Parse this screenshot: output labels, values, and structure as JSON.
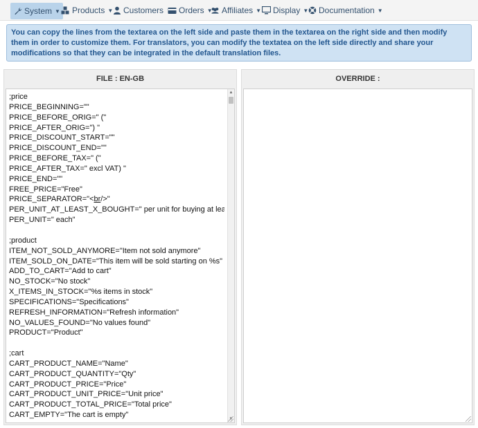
{
  "nav": {
    "items": [
      {
        "label": "System",
        "icon": "wrench-icon",
        "active": true
      },
      {
        "label": "Products",
        "icon": "cubes-icon"
      },
      {
        "label": "Customers",
        "icon": "user-icon"
      },
      {
        "label": "Orders",
        "icon": "credit-card-icon"
      },
      {
        "label": "Affiliates",
        "icon": "users-icon"
      },
      {
        "label": "Display",
        "icon": "monitor-icon"
      },
      {
        "label": "Documentation",
        "icon": "lifebuoy-icon"
      }
    ]
  },
  "info": {
    "text": "You can copy the lines from the textarea on the left side and paste them in the textarea on the right side and then modify them in order to customize them. For translators, you can modify the textatea on the left side directly and share your modifications so that they can be integrated in the default translation files."
  },
  "left_panel": {
    "title": "FILE : EN-GB",
    "lines": [
      ";price",
      "PRICE_BEGINNING=\"\"",
      "PRICE_BEFORE_ORIG=\" (\"",
      "PRICE_AFTER_ORIG=\") \"",
      "PRICE_DISCOUNT_START=\"\"",
      "PRICE_DISCOUNT_END=\"\"",
      "PRICE_BEFORE_TAX=\" (\"",
      "PRICE_AFTER_TAX=\" excl VAT) \"",
      "PRICE_END=\"\"",
      "FREE_PRICE=\"Free\"",
      "PRICE_SEPARATOR=\"<br/>\"",
      "PER_UNIT_AT_LEAST_X_BOUGHT=\" per unit for buying at least %s\"",
      "PER_UNIT=\" each\"",
      "",
      ";product",
      "ITEM_NOT_SOLD_ANYMORE=\"Item not sold anymore\"",
      "ITEM_SOLD_ON_DATE=\"This item will be sold starting on %s\"",
      "ADD_TO_CART=\"Add to cart\"",
      "NO_STOCK=\"No stock\"",
      "X_ITEMS_IN_STOCK=\"%s items in stock\"",
      "SPECIFICATIONS=\"Specifications\"",
      "REFRESH_INFORMATION=\"Refresh information\"",
      "NO_VALUES_FOUND=\"No values found\"",
      "PRODUCT=\"Product\"",
      "",
      ";cart",
      "CART_PRODUCT_NAME=\"Name\"",
      "CART_PRODUCT_QUANTITY=\"Qty\"",
      "CART_PRODUCT_PRICE=\"Price\"",
      "CART_PRODUCT_UNIT_PRICE=\"Unit price\"",
      "CART_PRODUCT_TOTAL_PRICE=\"Total price\"",
      "CART_EMPTY=\"The cart is empty\""
    ]
  },
  "right_panel": {
    "title": "OVERRIDE :",
    "value": ""
  }
}
